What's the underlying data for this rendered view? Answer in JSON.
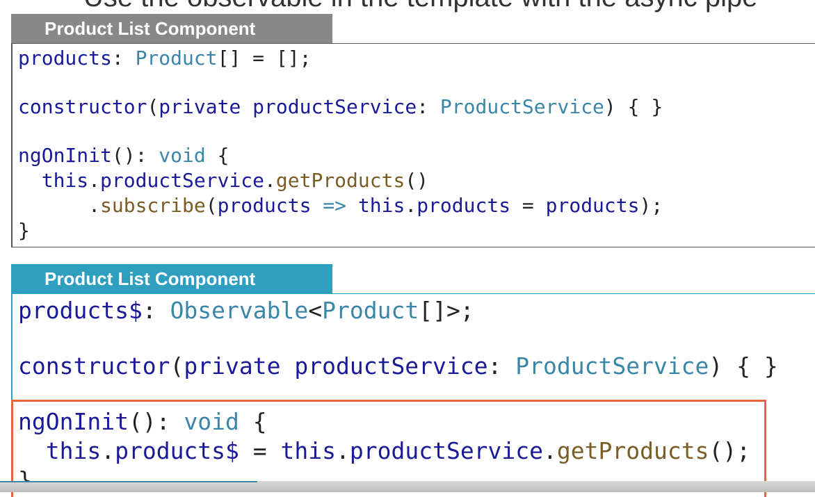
{
  "top_strip_text": "Use the observable in the template with the async pipe",
  "tabs": {
    "top": "Product List Component",
    "bottom": "Product List Component"
  },
  "top_code": {
    "line1": [
      {
        "t": "products",
        "c": "kw"
      },
      {
        "t": ": ",
        "c": "pl"
      },
      {
        "t": "Product",
        "c": "ty"
      },
      {
        "t": "[] = [];",
        "c": "pl"
      }
    ],
    "line2": [
      {
        "t": "constructor",
        "c": "kw"
      },
      {
        "t": "(",
        "c": "pl"
      },
      {
        "t": "private",
        "c": "kw"
      },
      {
        "t": " productService",
        "c": "kw"
      },
      {
        "t": ": ",
        "c": "pl"
      },
      {
        "t": "ProductService",
        "c": "ty"
      },
      {
        "t": ") { }",
        "c": "pl"
      }
    ],
    "line3": [
      {
        "t": "ngOnInit",
        "c": "kw"
      },
      {
        "t": "(): ",
        "c": "pl"
      },
      {
        "t": "void",
        "c": "ty"
      },
      {
        "t": " {",
        "c": "pl"
      }
    ],
    "line4": [
      {
        "t": "  this",
        "c": "kw"
      },
      {
        "t": ".",
        "c": "pl"
      },
      {
        "t": "productService",
        "c": "kw"
      },
      {
        "t": ".",
        "c": "pl"
      },
      {
        "t": "getProducts",
        "c": "fn"
      },
      {
        "t": "()",
        "c": "pl"
      }
    ],
    "line5": [
      {
        "t": "      .",
        "c": "pl"
      },
      {
        "t": "subscribe",
        "c": "fn"
      },
      {
        "t": "(",
        "c": "pl"
      },
      {
        "t": "products",
        "c": "kw"
      },
      {
        "t": " => ",
        "c": "ty"
      },
      {
        "t": "this",
        "c": "kw"
      },
      {
        "t": ".",
        "c": "pl"
      },
      {
        "t": "products",
        "c": "kw"
      },
      {
        "t": " = ",
        "c": "pl"
      },
      {
        "t": "products",
        "c": "kw"
      },
      {
        "t": ");",
        "c": "pl"
      }
    ],
    "line6": [
      {
        "t": "}",
        "c": "pl"
      }
    ]
  },
  "bottom_code": {
    "line1": [
      {
        "t": "products$",
        "c": "kw"
      },
      {
        "t": ": ",
        "c": "pl"
      },
      {
        "t": "Observable",
        "c": "ty"
      },
      {
        "t": "<",
        "c": "pl"
      },
      {
        "t": "Product",
        "c": "ty"
      },
      {
        "t": "[]>;",
        "c": "pl"
      }
    ],
    "line2": [
      {
        "t": "constructor",
        "c": "kw"
      },
      {
        "t": "(",
        "c": "pl"
      },
      {
        "t": "private",
        "c": "kw"
      },
      {
        "t": " productService",
        "c": "kw"
      },
      {
        "t": ": ",
        "c": "pl"
      },
      {
        "t": "ProductService",
        "c": "ty"
      },
      {
        "t": ") { }",
        "c": "pl"
      }
    ],
    "line3": [
      {
        "t": "ngOnInit",
        "c": "kw"
      },
      {
        "t": "(): ",
        "c": "pl"
      },
      {
        "t": "void",
        "c": "ty"
      },
      {
        "t": " {",
        "c": "pl"
      }
    ],
    "line4": [
      {
        "t": "  this",
        "c": "kw"
      },
      {
        "t": ".",
        "c": "pl"
      },
      {
        "t": "products$",
        "c": "kw"
      },
      {
        "t": " = ",
        "c": "pl"
      },
      {
        "t": "this",
        "c": "kw"
      },
      {
        "t": ".",
        "c": "pl"
      },
      {
        "t": "productService",
        "c": "kw"
      },
      {
        "t": ".",
        "c": "pl"
      },
      {
        "t": "getProducts",
        "c": "fn"
      },
      {
        "t": "();",
        "c": "pl"
      }
    ],
    "line5": [
      {
        "t": "}",
        "c": "pl"
      }
    ]
  },
  "colors": {
    "grey_tab": "#888888",
    "blue_tab": "#2f9fbf",
    "highlight_border": "#e8643c"
  }
}
